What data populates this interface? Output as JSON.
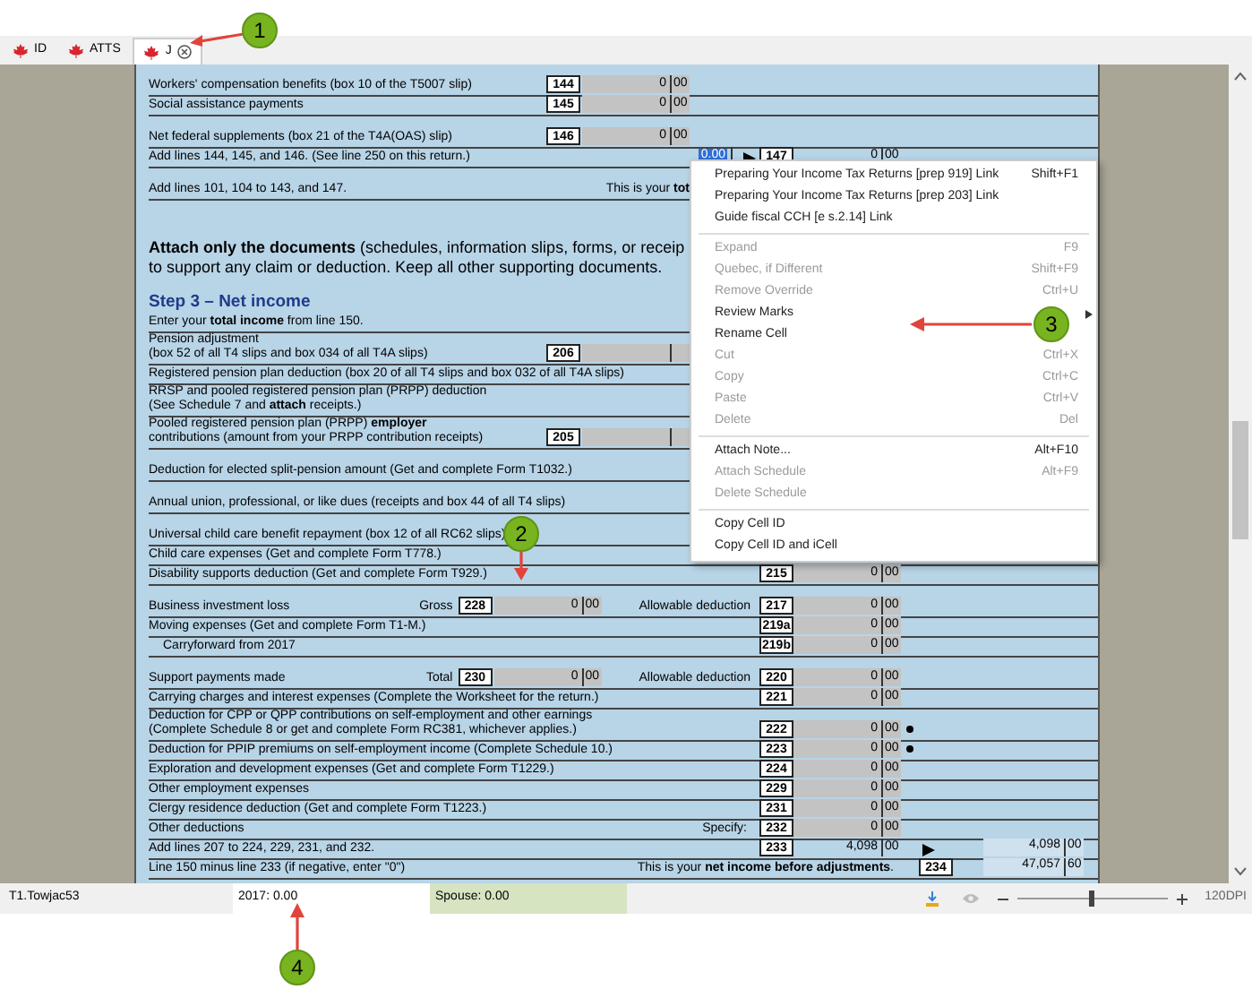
{
  "tabs": [
    {
      "label": "ID",
      "selected": false,
      "closable": false
    },
    {
      "label": "ATTS",
      "selected": false,
      "closable": false
    },
    {
      "label": "J",
      "selected": true,
      "closable": true
    }
  ],
  "form": {
    "rows": [
      {
        "kind": "line",
        "label": "Workers' compensation benefits (box 10 of the T5007 slip)",
        "inner": {
          "code": "144",
          "value": "0",
          "cents": "00",
          "shaded": true
        }
      },
      {
        "kind": "line",
        "label": "Social assistance payments",
        "inner": {
          "code": "145",
          "value": "0",
          "cents": "00",
          "shaded": true
        }
      },
      {
        "kind": "gap"
      },
      {
        "kind": "line",
        "label": "Net federal supplements (box 21 of the T4A(OAS) slip)",
        "inner": {
          "code": "146",
          "value": "0",
          "cents": "00",
          "shaded": true
        }
      },
      {
        "kind": "line",
        "label": "Add lines 144, 145, and 146. (See line 250 on this return.)",
        "inner": {
          "value": "0.00",
          "selected": true,
          "shaded": false
        },
        "main": {
          "arrow": true,
          "code": "147",
          "value": "0",
          "cents": "00",
          "shaded": false
        }
      },
      {
        "kind": "gap"
      },
      {
        "kind": "line",
        "label": "Add lines 101, 104 to 143, and 147.",
        "prefix": "This is your **tot**"
      },
      {
        "kind": "gap"
      },
      {
        "kind": "gap"
      },
      {
        "kind": "gap"
      },
      {
        "kind": "note",
        "label": "**Attach only the documents** (schedules, information slips, forms, or receip"
      },
      {
        "kind": "note",
        "label": "to support any claim or deduction. Keep all other supporting documents."
      },
      {
        "kind": "gap"
      },
      {
        "kind": "heading",
        "label": "Step 3 – Net income"
      },
      {
        "kind": "line",
        "label": "Enter your **total income** from line 150."
      },
      {
        "kind": "line",
        "label": "Pension adjustment\n(box 52 of all T4 slips and box 034 of all T4A slips)",
        "inner": {
          "code": "206",
          "shaded": true
        }
      },
      {
        "kind": "line",
        "label": "Registered pension plan deduction (box 20 of all T4 slips and box 032 of all T4A slips)"
      },
      {
        "kind": "line",
        "label": "RRSP and pooled registered pension plan (PRPP) deduction\n(See Schedule 7 and **attach** receipts.)"
      },
      {
        "kind": "line",
        "label": "Pooled registered pension plan (PRPP) **employer**\ncontributions (amount from your PRPP contribution receipts)",
        "inner": {
          "code": "205",
          "shaded": true
        }
      },
      {
        "kind": "gap"
      },
      {
        "kind": "line",
        "label": "Deduction for elected split-pension amount (Get and complete Form T1032.)"
      },
      {
        "kind": "gap"
      },
      {
        "kind": "line",
        "label": "Annual union, professional, or like dues (receipts and box 44 of all T4 slips)"
      },
      {
        "kind": "gap"
      },
      {
        "kind": "line",
        "label": "Universal child care benefit repayment (box 12 of all RC62 slips)"
      },
      {
        "kind": "line",
        "label": "Child care expenses (Get and complete Form T778.)"
      },
      {
        "kind": "line",
        "label": "Disability supports deduction (Get and complete Form T929.)",
        "main": {
          "code": "215",
          "value": "0",
          "cents": "00",
          "shaded": true
        }
      },
      {
        "kind": "gap"
      },
      {
        "kind": "line",
        "label": "Business investment loss",
        "inner": {
          "text": "Gross",
          "code": "228",
          "value": "0",
          "cents": "00",
          "shaded": true
        },
        "prefix": "Allowable deduction",
        "main": {
          "code": "217",
          "value": "0",
          "cents": "00",
          "shaded": true
        }
      },
      {
        "kind": "line",
        "label": "Moving expenses (Get and complete Form T1-M.)",
        "main": {
          "code": "219a",
          "value": "0",
          "cents": "00",
          "shaded": true
        }
      },
      {
        "kind": "line",
        "indent": true,
        "label": "Carryforward from 2017",
        "main": {
          "code": "219b",
          "value": "0",
          "cents": "00",
          "shaded": true
        }
      },
      {
        "kind": "gap"
      },
      {
        "kind": "line",
        "label": "Support payments made",
        "inner": {
          "text": "Total",
          "code": "230",
          "value": "0",
          "cents": "00",
          "shaded": true
        },
        "prefix": "Allowable deduction",
        "main": {
          "code": "220",
          "value": "0",
          "cents": "00",
          "shaded": true
        }
      },
      {
        "kind": "line",
        "label": "Carrying charges and interest expenses (Complete the Worksheet for the return.)",
        "main": {
          "code": "221",
          "value": "0",
          "cents": "00",
          "shaded": true
        }
      },
      {
        "kind": "line",
        "label": "Deduction for CPP or QPP contributions on self-employment and other earnings\n(Complete Schedule 8 or get and complete Form RC381, whichever applies.)",
        "main": {
          "code": "222",
          "value": "0",
          "cents": "00",
          "shaded": true
        },
        "dot": true
      },
      {
        "kind": "line",
        "label": "Deduction for PPIP premiums on self-employment income (Complete Schedule 10.)",
        "main": {
          "code": "223",
          "value": "0",
          "cents": "00",
          "shaded": true
        },
        "dot": true
      },
      {
        "kind": "line",
        "label": "Exploration and development expenses (Get and complete Form T1229.)",
        "main": {
          "code": "224",
          "value": "0",
          "cents": "00",
          "shaded": true
        }
      },
      {
        "kind": "line",
        "label": "Other employment expenses",
        "main": {
          "code": "229",
          "value": "0",
          "cents": "00",
          "shaded": true
        }
      },
      {
        "kind": "line",
        "label": "Clergy residence deduction (Get and complete Form T1223.)",
        "main": {
          "code": "231",
          "value": "0",
          "cents": "00",
          "shaded": true
        }
      },
      {
        "kind": "line",
        "label": "Other deductions",
        "inner": {
          "text": "Specify:"
        },
        "main": {
          "code": "232",
          "value": "0",
          "cents": "00",
          "shaded": true
        }
      },
      {
        "kind": "line",
        "label": "Add lines 207 to 224, 229, 231, and 232.",
        "main": {
          "code": "233",
          "value": "4,098",
          "cents": "00",
          "shaded": false
        },
        "total": {
          "arrow": true,
          "value": "4,098",
          "cents": "00"
        }
      },
      {
        "kind": "line",
        "label": "Line 150 minus line 233 (if negative, enter \"0\")",
        "prefix": "This is your **net income before adjustments**.",
        "total": {
          "code": "234",
          "value": "47,057",
          "cents": "60"
        }
      }
    ]
  },
  "menu": [
    {
      "kind": "item",
      "label": "Preparing Your Income Tax Returns [prep 919] Link",
      "shortcut": "Shift+F1",
      "disabled": false,
      "submenu": false
    },
    {
      "kind": "item",
      "label": "Preparing Your Income Tax Returns [prep 203] Link",
      "disabled": false,
      "submenu": false
    },
    {
      "kind": "item",
      "label": "Guide fiscal CCH [e s.2.14] Link",
      "disabled": false,
      "submenu": false
    },
    {
      "kind": "separator"
    },
    {
      "kind": "item",
      "label": "Expand",
      "shortcut": "F9",
      "disabled": true,
      "submenu": false
    },
    {
      "kind": "item",
      "label": "Quebec, if Different",
      "shortcut": "Shift+F9",
      "disabled": true,
      "submenu": false
    },
    {
      "kind": "item",
      "label": "Remove Override",
      "shortcut": "Ctrl+U",
      "disabled": true,
      "submenu": false
    },
    {
      "kind": "item",
      "label": "Review Marks",
      "disabled": false,
      "submenu": true
    },
    {
      "kind": "item",
      "label": "Rename Cell",
      "disabled": false,
      "submenu": false
    },
    {
      "kind": "item",
      "label": "Cut",
      "shortcut": "Ctrl+X",
      "disabled": true,
      "submenu": false
    },
    {
      "kind": "item",
      "label": "Copy",
      "shortcut": "Ctrl+C",
      "disabled": true,
      "submenu": false
    },
    {
      "kind": "item",
      "label": "Paste",
      "shortcut": "Ctrl+V",
      "disabled": true,
      "submenu": false
    },
    {
      "kind": "item",
      "label": "Delete",
      "shortcut": "Del",
      "disabled": true,
      "submenu": false
    },
    {
      "kind": "separator"
    },
    {
      "kind": "item",
      "label": "Attach Note...",
      "shortcut": "Alt+F10",
      "disabled": false,
      "submenu": false
    },
    {
      "kind": "item",
      "label": "Attach Schedule",
      "shortcut": "Alt+F9",
      "disabled": true,
      "submenu": false
    },
    {
      "kind": "item",
      "label": "Delete Schedule",
      "disabled": true,
      "submenu": false
    },
    {
      "kind": "separator"
    },
    {
      "kind": "item",
      "label": "Copy Cell ID",
      "disabled": false,
      "submenu": false
    },
    {
      "kind": "item",
      "label": "Copy Cell ID and iCell",
      "disabled": false,
      "submenu": false
    }
  ],
  "status_bar": {
    "file": "T1.Towjac53",
    "year_total": "2017: 0.00",
    "spouse": "Spouse: 0.00",
    "zoom": {
      "level": 0.5
    },
    "dpi": "120DPI"
  },
  "callouts": [
    {
      "label": "1"
    },
    {
      "label": "2"
    },
    {
      "label": "3"
    },
    {
      "label": "4"
    }
  ]
}
